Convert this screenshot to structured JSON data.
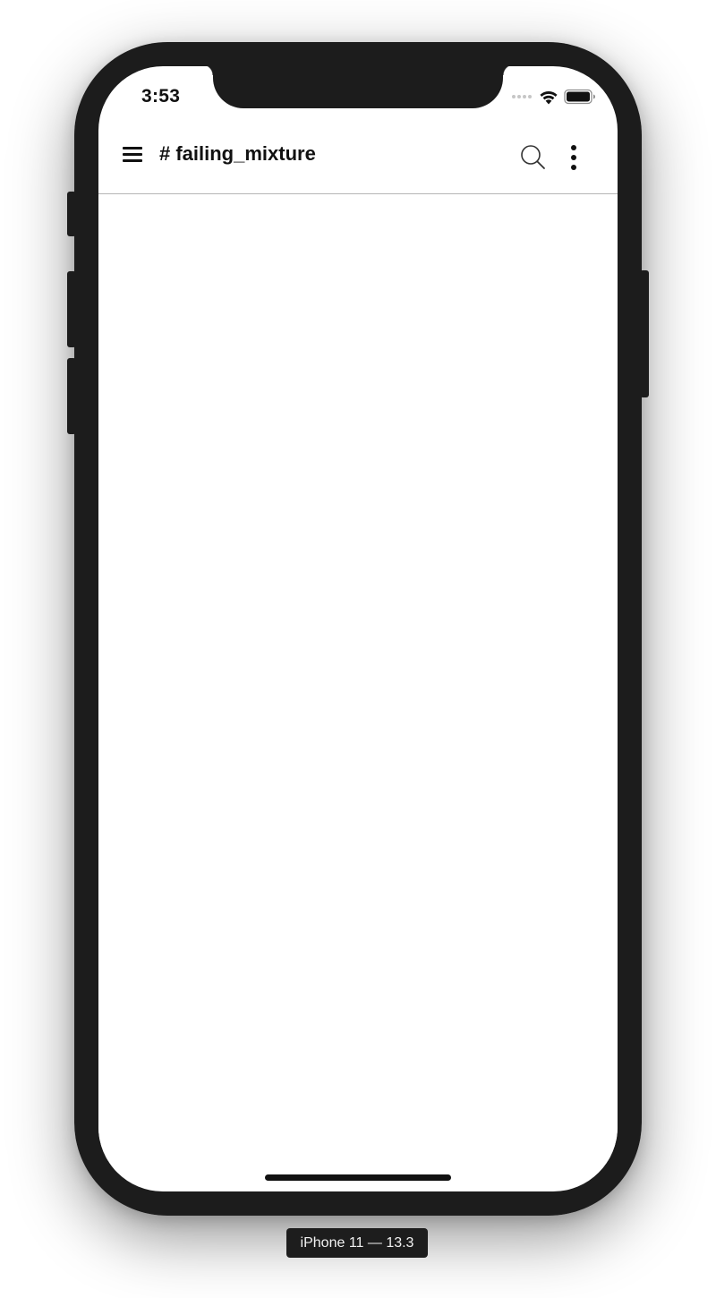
{
  "status_bar": {
    "time": "3:53",
    "icons": [
      "cellular-signal-icon",
      "wifi-icon",
      "battery-icon"
    ]
  },
  "header": {
    "title": "# failing_mixture",
    "left_icon": "hamburger-menu-icon",
    "right_icons": [
      "search-icon",
      "more-vertical-icon"
    ]
  },
  "device": {
    "label": "iPhone 11 — 13.3"
  },
  "colors": {
    "frame": "#1c1c1c",
    "screen": "#ffffff",
    "divider": "#b5b5b5",
    "text": "#111111"
  }
}
